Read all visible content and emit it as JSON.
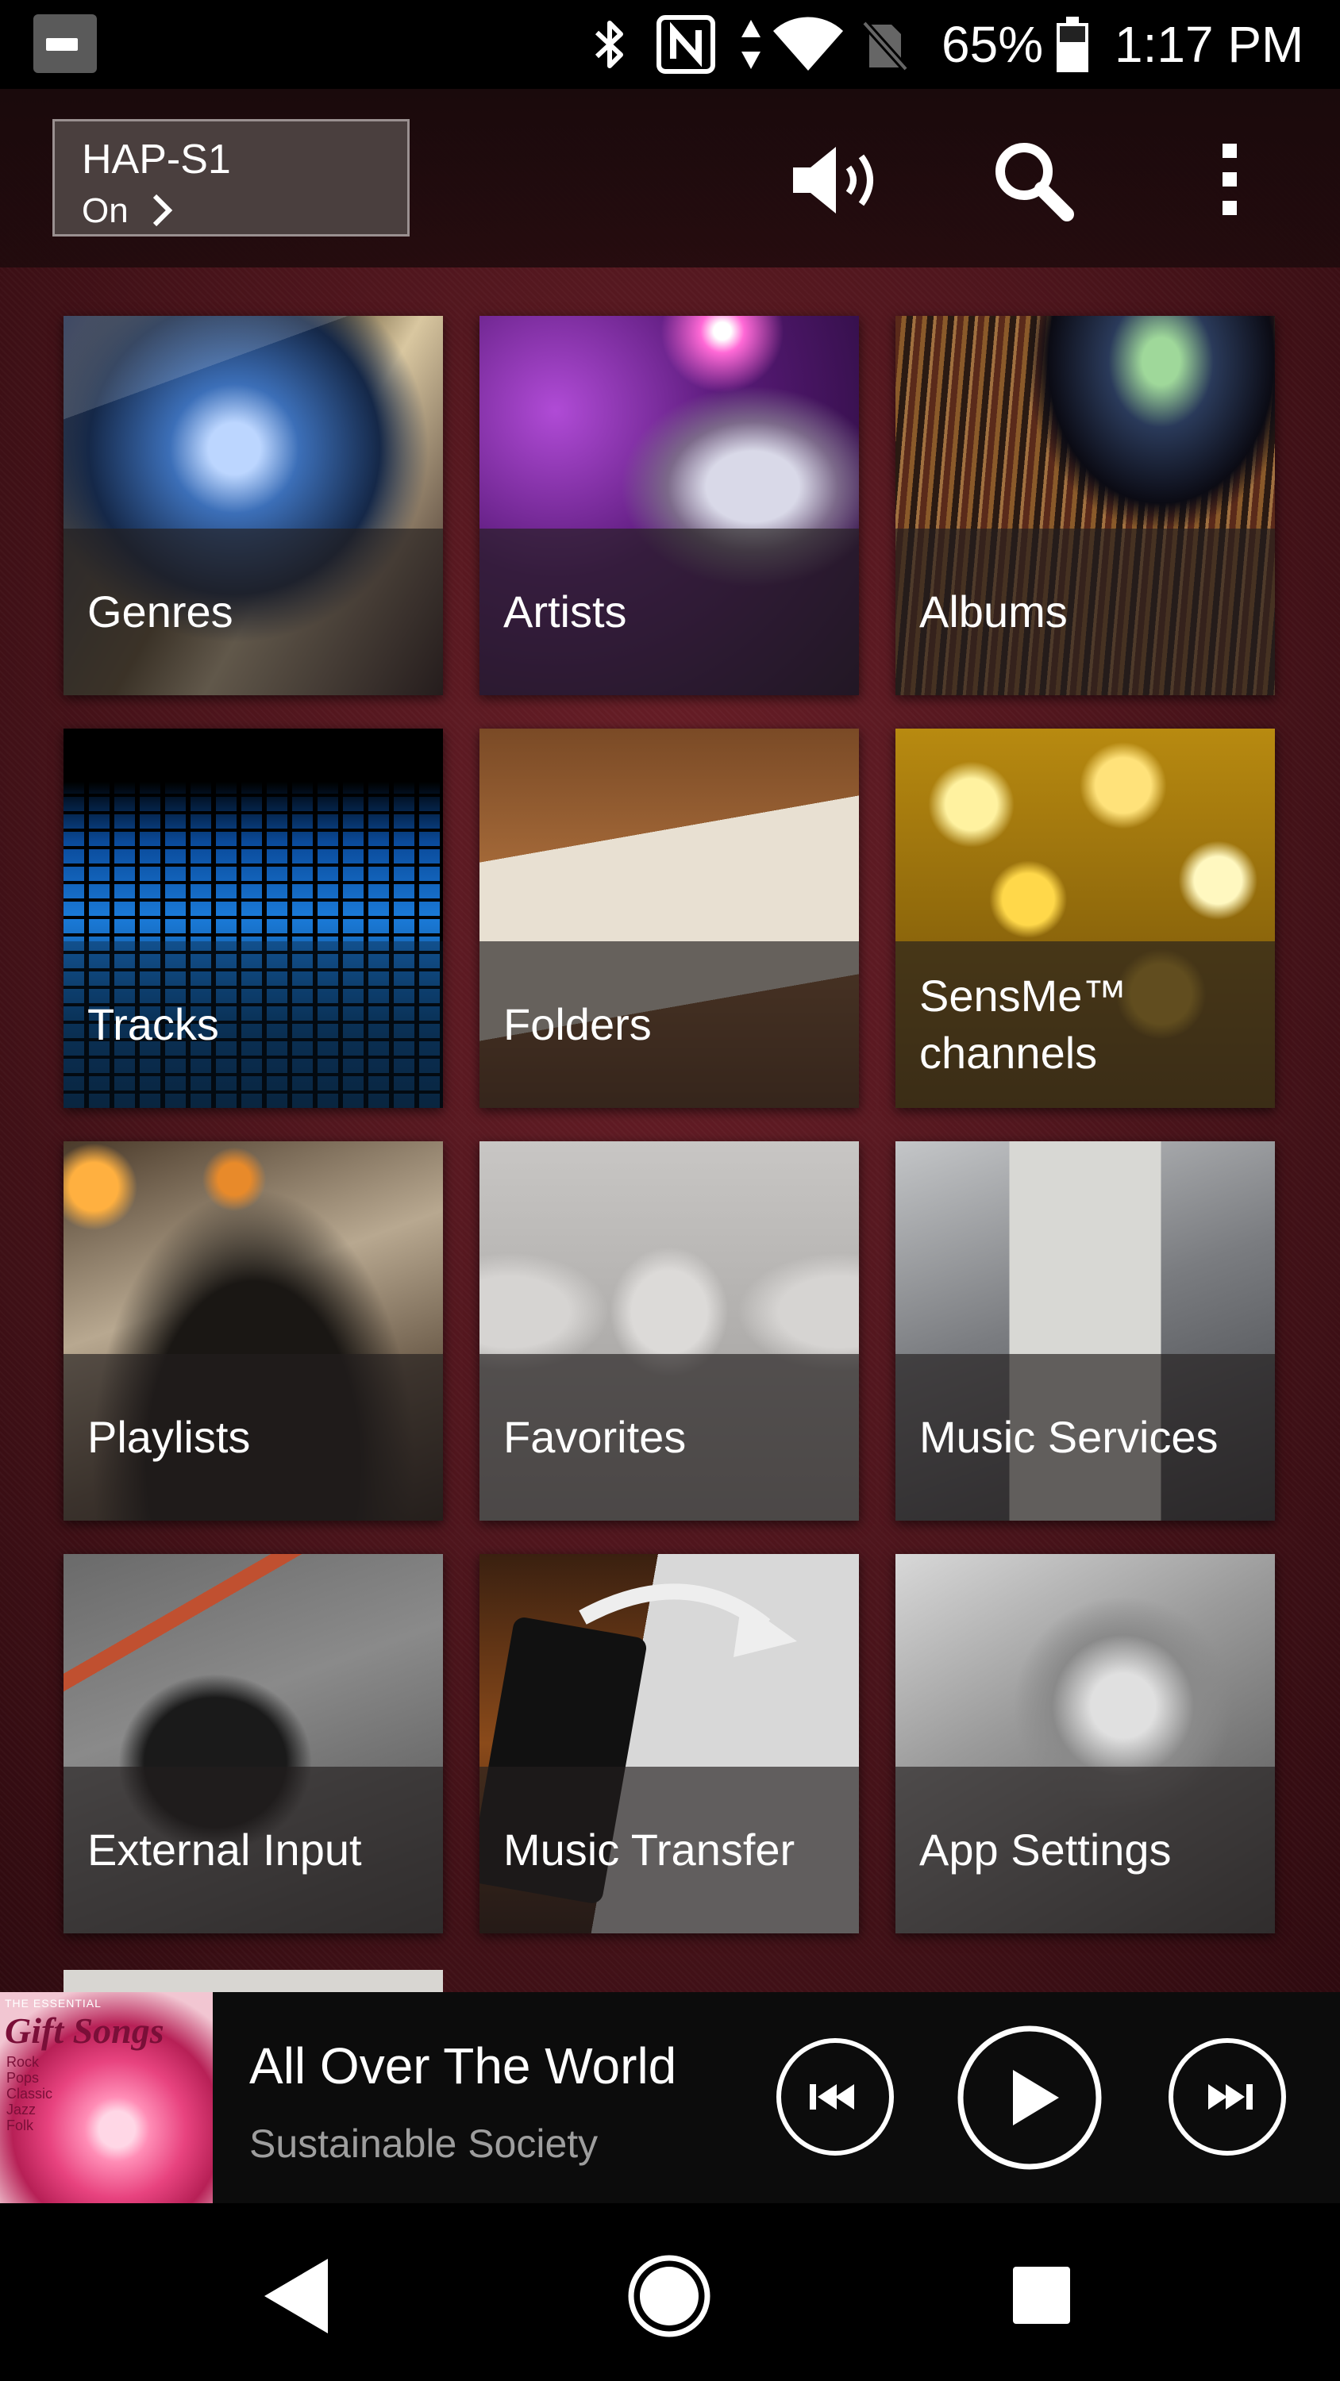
{
  "status_bar": {
    "battery_percent": "65%",
    "time": "1:17 PM",
    "icons": [
      "app-notification-icon",
      "bluetooth-icon",
      "nfc-icon",
      "data-transfer-icon",
      "wifi-icon",
      "no-sim-icon",
      "battery-icon"
    ]
  },
  "device": {
    "name": "HAP-S1",
    "status": "On"
  },
  "toolbar": {
    "icons": [
      "volume-icon",
      "search-icon",
      "more-vert-icon"
    ]
  },
  "categories": [
    {
      "label": "Genres"
    },
    {
      "label": "Artists"
    },
    {
      "label": "Albums"
    },
    {
      "label": "Tracks"
    },
    {
      "label": "Folders"
    },
    {
      "label": "SensMe™ channels"
    },
    {
      "label": "Playlists"
    },
    {
      "label": "Favorites"
    },
    {
      "label": "Music Services"
    },
    {
      "label": "External Input"
    },
    {
      "label": "Music Transfer"
    },
    {
      "label": "App Settings"
    }
  ],
  "now_playing": {
    "title": "All Over The World",
    "artist": "Sustainable Society",
    "album_art": {
      "line1": "THE ESSENTIAL",
      "line2": "Gift Songs",
      "genres": "Rock\nPops\nClassic\nJazz\nFolk"
    },
    "controls": [
      "previous-icon",
      "play-icon",
      "next-icon"
    ]
  },
  "nav_bar": {
    "icons": [
      "back-icon",
      "home-icon",
      "recents-icon"
    ]
  },
  "colors": {
    "wallpaper": "#4a141b",
    "tile_label_overlay": "#231e1e",
    "artist_text": "#9e9e9e"
  }
}
